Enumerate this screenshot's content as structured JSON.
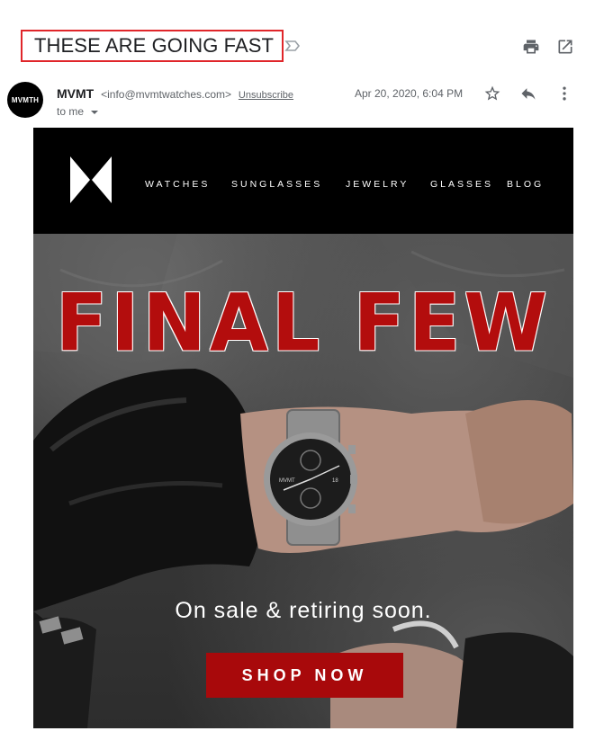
{
  "subject": {
    "text": "THESE ARE GOING FAST",
    "highlight_color": "#e0262a"
  },
  "header_icons": [
    "print-icon",
    "open-in-new-window-icon"
  ],
  "sender": {
    "avatar_text": "MVMTH",
    "name": "MVMT",
    "email": "<info@mvmtwatches.com>",
    "unsubscribe": "Unsubscribe",
    "to": "to me",
    "date": "Apr 20, 2020, 6:04 PM"
  },
  "row_icons": [
    "star-icon",
    "reply-icon",
    "more-options-icon"
  ],
  "email_body": {
    "nav": [
      "WATCHES",
      "SUNGLASSES",
      "JEWELRY",
      "GLASSES",
      "BLOG"
    ],
    "headline": "FINAL FEW",
    "subheadline": "On sale & retiring soon.",
    "cta": "SHOP NOW",
    "watch_brand": "MVMT",
    "watch_date": "18",
    "colors": {
      "headline": "#b30d0d",
      "cta": "#a8090b",
      "nav_bg": "#000000"
    }
  }
}
